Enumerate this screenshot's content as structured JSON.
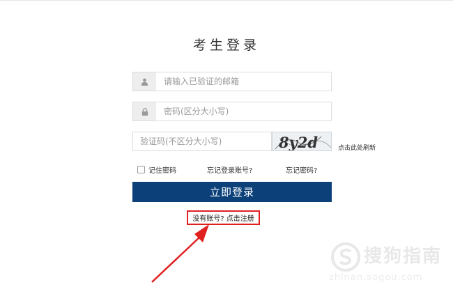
{
  "page": {
    "title": "考生登录"
  },
  "form": {
    "email_placeholder": "请输入已验证的邮箱",
    "password_placeholder": "密码(区分大小写)",
    "captcha_placeholder": "验证码(不区分大小写)",
    "captcha_text": "8y2d",
    "refresh_label": "点击此处刷新",
    "remember_label": "记住密码",
    "forgot_account_label": "忘记登录账号?",
    "forgot_password_label": "忘记密码?",
    "login_label": "立即登录",
    "register_label": "没有账号? 点击注册"
  },
  "watermark": {
    "name": "搜狗指南",
    "url": "zhinan.sogou.com"
  },
  "colors": {
    "login_button": "#0b4079",
    "annotation_red": "#e01f1f",
    "icon_box": "#eeeeee",
    "border": "#dcdcdc"
  },
  "icons": [
    "user-icon",
    "lock-icon",
    "checkbox-icon",
    "annotation-arrow-icon",
    "sogou-logo-icon"
  ]
}
